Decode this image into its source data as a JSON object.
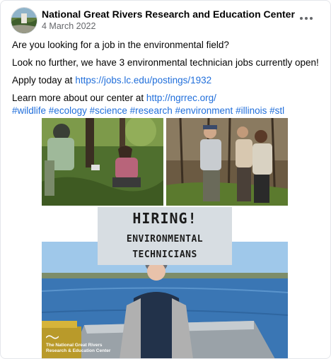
{
  "post": {
    "page_name": "National Great Rivers Research and Education Center",
    "date": "4 March 2022",
    "more_icon": "more-horizontal-icon"
  },
  "body": {
    "line1": "Are you looking for a job in the environmental field?",
    "line2": "Look no further, we have 3 environmental technician jobs currently open!",
    "apply_prefix": "Apply today at ",
    "apply_link": "https://jobs.lc.edu/postings/1932",
    "learn_prefix": "Learn more about our center at ",
    "learn_link": "http://ngrrec.org/",
    "hashtags": [
      "#wildlife",
      "#ecology",
      "#science",
      "#research",
      "#environment",
      "#illinois",
      "#stl"
    ]
  },
  "image": {
    "hiring_title": "HIRING!",
    "hiring_line1": "ENVIRONMENTAL",
    "hiring_line2": "TECHNICIANS",
    "watermark_line1": "The National Great Rivers",
    "watermark_line2": "Research & Education Center"
  },
  "colors": {
    "link": "#216fdb",
    "secondary_text": "#65676b",
    "hiring_box": "#d7dde2"
  }
}
